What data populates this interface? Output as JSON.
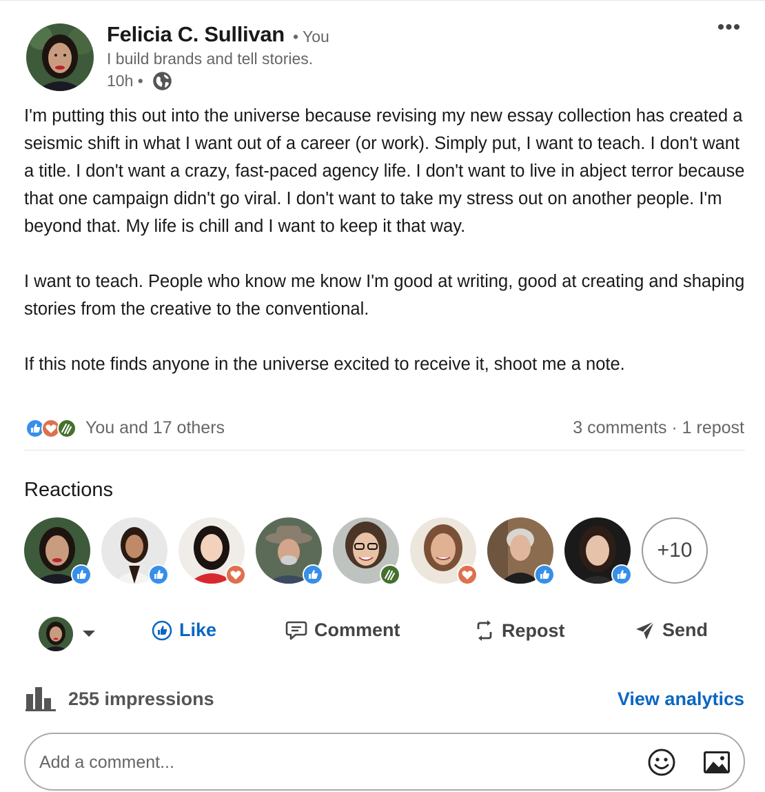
{
  "post": {
    "author": {
      "name": "Felicia C. Sullivan",
      "relation": "• You",
      "headline": "I build brands and tell stories.",
      "time": "10h •"
    },
    "more_label": "•••",
    "body": {
      "p1": "I'm putting this out into the universe because revising my new essay collection has created a seismic shift in what I want out of a career (or work). Simply put, I want to teach. I don't want a title. I don't want a crazy, fast-paced agency life. I don't want to live in abject terror because that one campaign didn't go viral. I don't want to take my stress out on another people. I'm beyond that. My life is chill and I want to keep it that way.",
      "p2": "I want to teach. People who know me know I'm good at writing, good at creating and shaping stories from the creative to the conventional.",
      "p3": "If this note finds anyone in the universe excited to receive it, shoot me a note."
    }
  },
  "social": {
    "reactions_summary": "You and 17 others",
    "comments_summary": "3 comments · 1 repost"
  },
  "reactions": {
    "title": "Reactions",
    "people": [
      {
        "reaction": "like-icon"
      },
      {
        "reaction": "like-icon"
      },
      {
        "reaction": "love-icon"
      },
      {
        "reaction": "like-icon"
      },
      {
        "reaction": "celebrate-icon"
      },
      {
        "reaction": "love-icon"
      },
      {
        "reaction": "like-icon"
      },
      {
        "reaction": "like-icon"
      }
    ],
    "more_label": "+10"
  },
  "actions": {
    "like": "Like",
    "comment": "Comment",
    "repost": "Repost",
    "send": "Send"
  },
  "analytics": {
    "impressions": "255 impressions",
    "link": "View analytics"
  },
  "comment_box": {
    "placeholder": "Add a comment..."
  },
  "colors": {
    "brand_blue": "#0a66c2",
    "love_orange": "#df704d",
    "celebrate_green": "#44712e"
  }
}
